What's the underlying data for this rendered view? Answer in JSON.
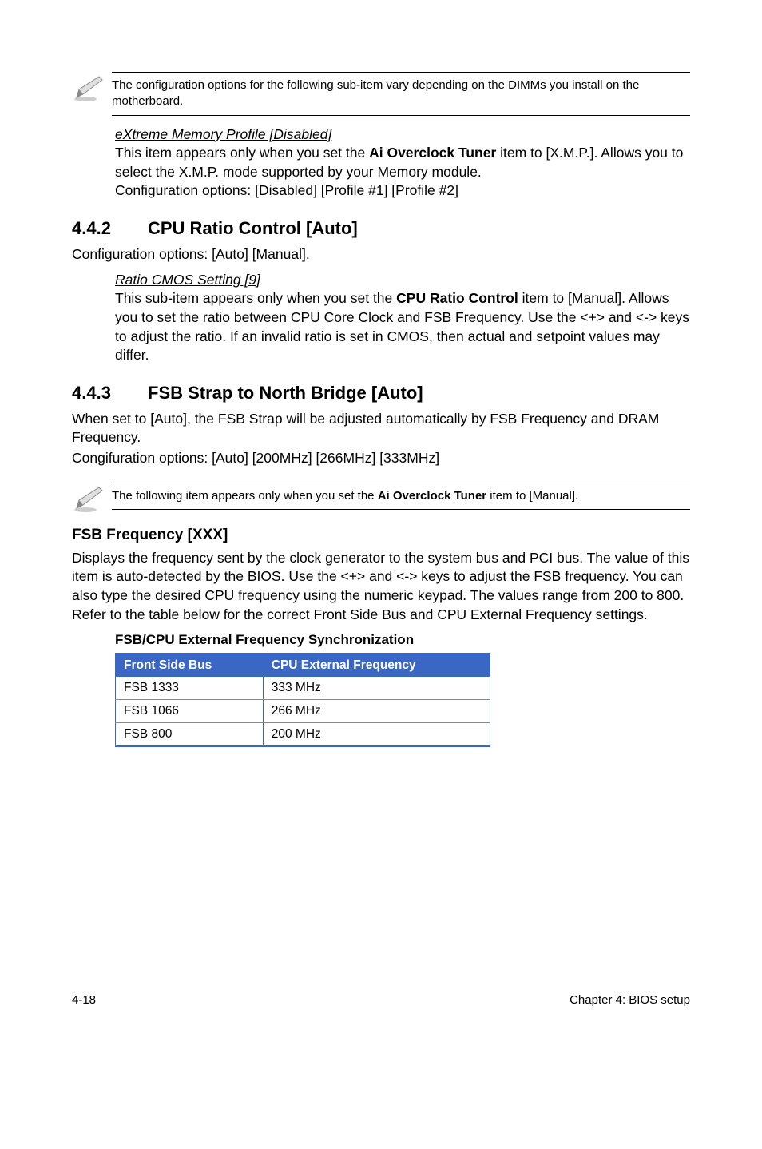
{
  "notes": {
    "note1": "The configuration options for the following sub-item vary depending on the DIMMs you install on the motherboard.",
    "note2_pre": "The following item appears only when you set the ",
    "note2_bold": "Ai Overclock Tuner",
    "note2_post": " item to [Manual]."
  },
  "section_xmp": {
    "heading": "eXtreme Memory Profile [Disabled]",
    "body_pre": "This item appears only when you set the ",
    "body_bold": "Ai Overclock Tuner",
    "body_post": " item to [X.M.P.]. Allows you to select the X.M.P. mode supported by your Memory module.",
    "opts": "Configuration options: [Disabled] [Profile #1] [Profile #2]"
  },
  "section_442": {
    "num": "4.4.2",
    "title": "CPU Ratio Control [Auto]",
    "body": "Configuration options: [Auto] [Manual].",
    "sub_heading": "Ratio CMOS Setting [9]",
    "sub_body_pre": "This sub-item appears only when you set the ",
    "sub_body_bold": "CPU Ratio Control",
    "sub_body_post": " item to [Manual]. Allows you to set the ratio between CPU Core Clock and FSB Frequency. Use the <+> and <-> keys to adjust the ratio. If an invalid ratio is set in CMOS, then actual and setpoint values may differ."
  },
  "section_443": {
    "num": "4.4.3",
    "title": "FSB Strap to North Bridge [Auto]",
    "body1": "When set to [Auto], the FSB Strap will be adjusted automatically by FSB Frequency and DRAM Frequency.",
    "body2": "Congifuration options: [Auto] [200MHz] [266MHz] [333MHz]"
  },
  "section_fsbfreq": {
    "title": "FSB Frequency [XXX]",
    "body": "Displays the frequency sent by the clock generator to the system bus and PCI bus. The value of this item is auto-detected by the BIOS. Use the <+> and <-> keys to adjust the FSB frequency. You can also type the desired CPU frequency using the numeric keypad. The values range from 200 to 800. Refer to the table below for the correct Front Side Bus and CPU External Frequency settings."
  },
  "table": {
    "caption": "FSB/CPU External Frequency Synchronization",
    "headers": {
      "c0": "Front Side Bus",
      "c1": "CPU External Frequency"
    },
    "rows": [
      {
        "c0": "FSB 1333",
        "c1": "333 MHz"
      },
      {
        "c0": "FSB 1066",
        "c1": "266 MHz"
      },
      {
        "c0": "FSB 800",
        "c1": "200 MHz"
      }
    ]
  },
  "footer": {
    "left": "4-18",
    "right": "Chapter 4: BIOS setup"
  }
}
